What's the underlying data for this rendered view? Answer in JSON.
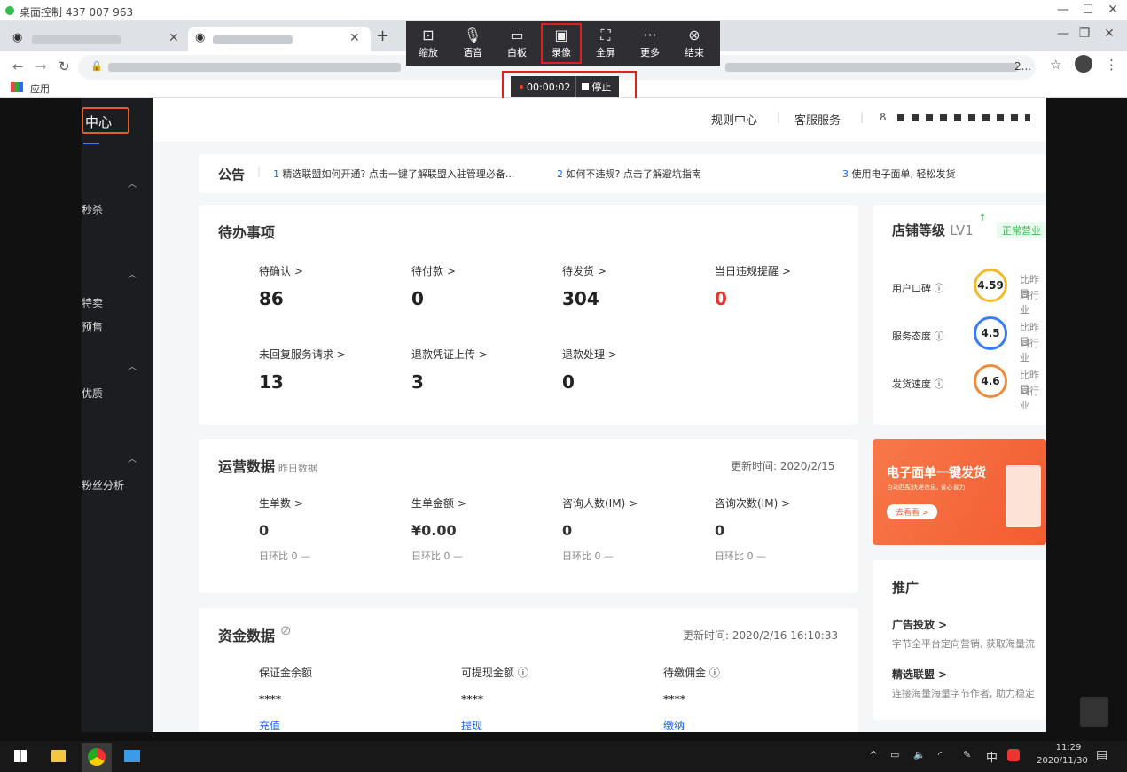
{
  "remote": {
    "title": "桌面控制 437 007 963"
  },
  "toolbar": {
    "items": [
      {
        "label": "缩放",
        "icon": "zoom-icon"
      },
      {
        "label": "语音",
        "icon": "mic-icon"
      },
      {
        "label": "白板",
        "icon": "whiteboard-icon"
      },
      {
        "label": "录像",
        "icon": "camera-icon"
      },
      {
        "label": "全屏",
        "icon": "fullscreen-icon"
      },
      {
        "label": "更多",
        "icon": "more-icon"
      },
      {
        "label": "结束",
        "icon": "close-circle-icon"
      }
    ],
    "rec_time": "00:00:02",
    "stop_label": "停止"
  },
  "browser": {
    "apps_label": "应用",
    "addr_tail": "2..."
  },
  "sidebar": {
    "title": "中心",
    "items": [
      "秒杀",
      "特卖",
      "预售",
      "优质",
      "粉丝分析"
    ]
  },
  "header": {
    "rules": "规则中心",
    "service": "客服服务"
  },
  "notice": {
    "title": "公告",
    "items": [
      {
        "n": "1",
        "text": "精选联盟如何开通? 点击一键了解联盟入驻管理必备..."
      },
      {
        "n": "2",
        "text": "如何不违规? 点击了解避坑指南"
      },
      {
        "n": "3",
        "text": "使用电子面单, 轻松发货"
      }
    ]
  },
  "todo": {
    "title": "待办事项",
    "items": [
      {
        "label": "待确认 >",
        "value": "86"
      },
      {
        "label": "待付款 >",
        "value": "0"
      },
      {
        "label": "待发货 >",
        "value": "304"
      },
      {
        "label": "当日违规提醒 >",
        "value": "0"
      },
      {
        "label": "未回复服务请求 >",
        "value": "13"
      },
      {
        "label": "退款凭证上传 >",
        "value": "3"
      },
      {
        "label": "退款处理 >",
        "value": "0"
      }
    ]
  },
  "shop": {
    "title": "店铺等级",
    "level": "LV1",
    "status": "正常营业",
    "rows": [
      {
        "label": "用户口碑 ⓘ",
        "score": "4.59",
        "cmp1": "比昨日",
        "cmp2": "同行业",
        "color": "#f2b92d"
      },
      {
        "label": "服务态度 ⓘ",
        "score": "4.5",
        "cmp1": "比昨日",
        "cmp2": "同行业",
        "color": "#3a7bf6"
      },
      {
        "label": "发货速度 ⓘ",
        "score": "4.6",
        "cmp1": "比昨日",
        "cmp2": "同行业",
        "color": "#f08a3c"
      }
    ]
  },
  "ops": {
    "title": "运营数据",
    "subtitle": "昨日数据",
    "updated": "更新时间: 2020/2/15",
    "items": [
      {
        "label": "生单数 >",
        "value": "0",
        "ratio": "日环比 0 —"
      },
      {
        "label": "生单金额 >",
        "value": "¥0.00",
        "ratio": "日环比 0 —"
      },
      {
        "label": "咨询人数(IM) >",
        "value": "0",
        "ratio": "日环比 0 —"
      },
      {
        "label": "咨询次数(IM) >",
        "value": "0",
        "ratio": "日环比 0 —"
      }
    ]
  },
  "banner": {
    "title": "电子面单一键发货",
    "sub": "自动匹配快递信息, 省心省力",
    "btn": "去看看 >"
  },
  "funds": {
    "title": "资金数据",
    "updated": "更新时间: 2020/2/16 16:10:33",
    "items": [
      {
        "label": "保证金余额",
        "value": "****",
        "action": "充值"
      },
      {
        "label": "可提现金额 ⓘ",
        "value": "****",
        "action": "提现"
      },
      {
        "label": "待缴佣金 ⓘ",
        "value": "****",
        "action": "缴纳"
      }
    ]
  },
  "promo": {
    "title": "推广",
    "items": [
      {
        "title": "广告投放 >",
        "desc": "字节全平台定向营销, 获取海量流"
      },
      {
        "title": "精选联盟 >",
        "desc": "连接海量海量字节作者, 助力稳定"
      }
    ]
  },
  "taskbar": {
    "time": "11:29",
    "date": "2020/11/30",
    "ime": "中"
  }
}
